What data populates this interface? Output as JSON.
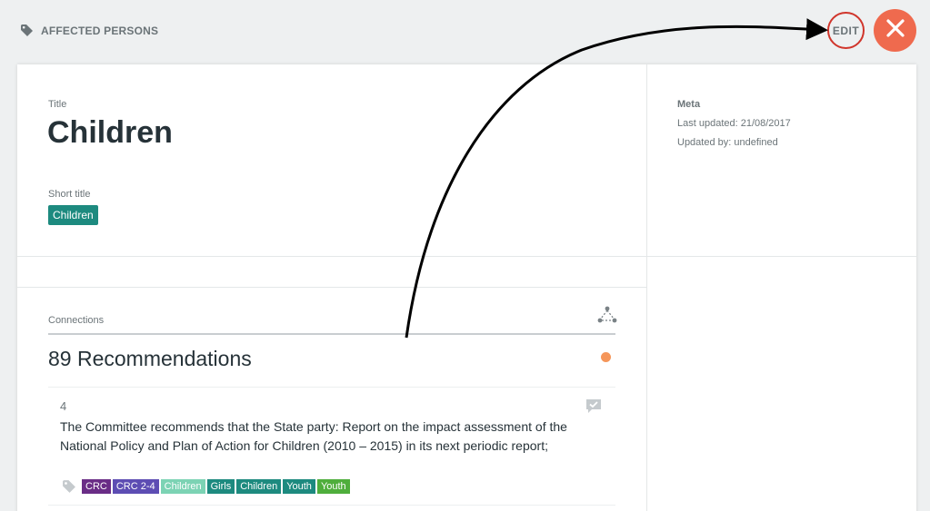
{
  "header": {
    "breadcrumb": "AFFECTED PERSONS",
    "edit_label": "EDIT",
    "close_icon": "close-icon"
  },
  "main": {
    "title_label": "Title",
    "title": "Children",
    "short_title_label": "Short title",
    "short_title": "Children"
  },
  "meta": {
    "heading": "Meta",
    "last_updated": "Last updated: 21/08/2017",
    "updated_by": "Updated by: undefined"
  },
  "connections": {
    "label": "Connections",
    "count_label": "89 Recommendations",
    "status_color": "#f5965a"
  },
  "recommendation": {
    "number": "4",
    "text": "The Committee recommends that the State party: Report on the impact assessment of the National Policy and Plan of Action for Children (2010 – 2015) in its next periodic report;",
    "tags": [
      {
        "label": "CRC",
        "color": "#6a2d86"
      },
      {
        "label": "CRC 2-4",
        "color": "#5d4db3"
      },
      {
        "label": "Children",
        "color": "#7cd3b4"
      },
      {
        "label": "Girls",
        "color": "#1d8a7f"
      },
      {
        "label": "Children",
        "color": "#1d8a7f"
      },
      {
        "label": "Youth",
        "color": "#1d8a7f"
      },
      {
        "label": "Youth",
        "color": "#4fae3c"
      }
    ]
  },
  "colors": {
    "accent_teal": "#1d8a7f",
    "close_button": "#ef6a4e",
    "edit_ring": "#d0352b"
  }
}
